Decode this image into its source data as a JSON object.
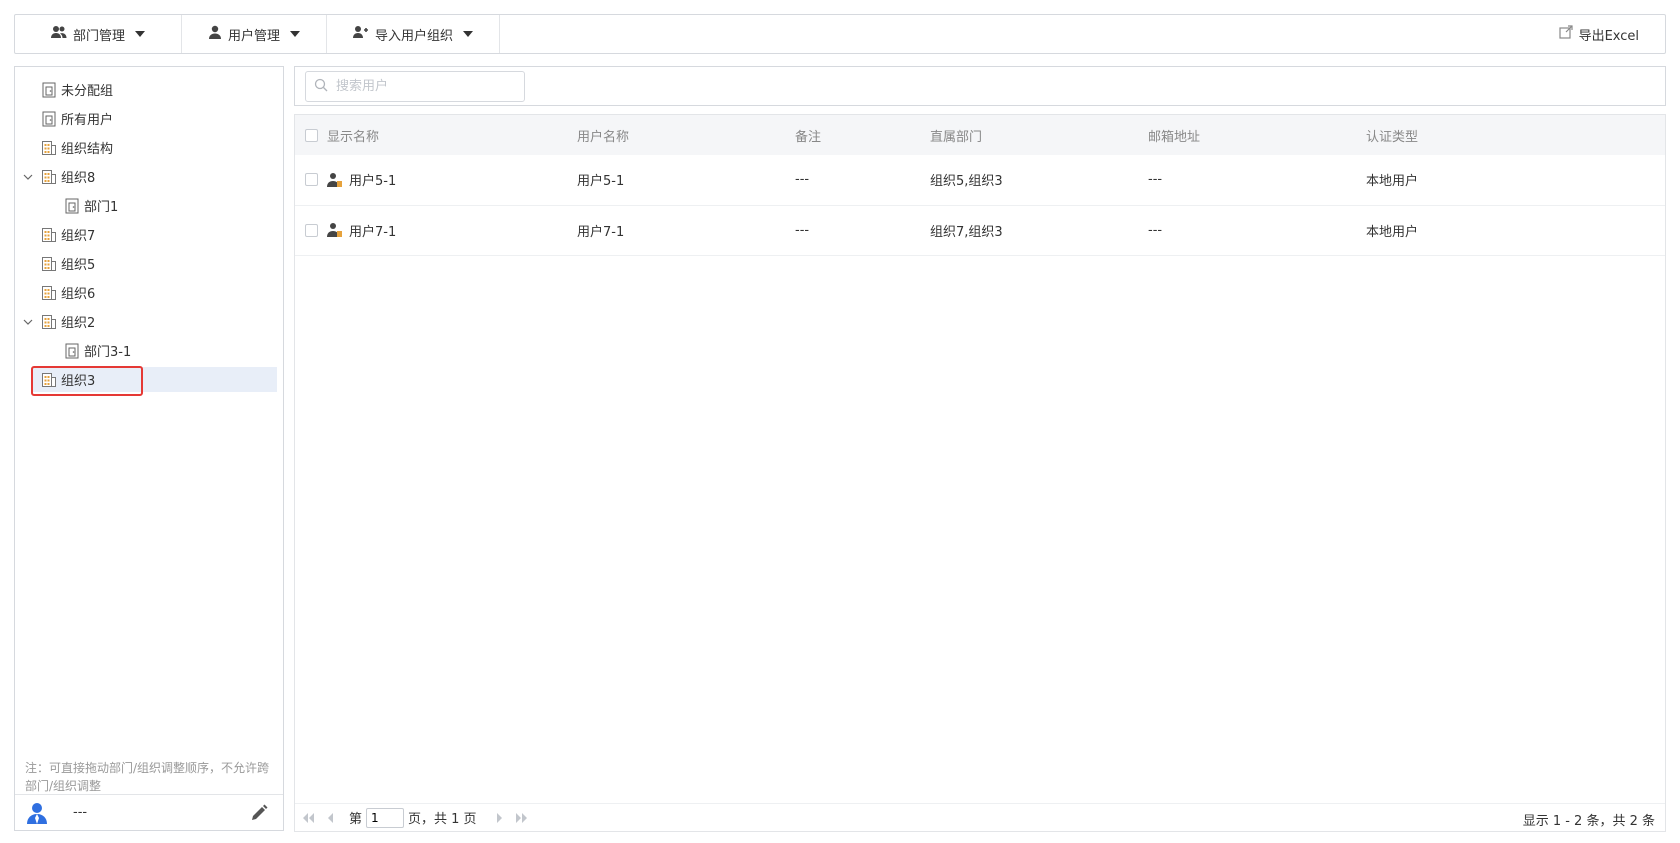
{
  "toolbar": {
    "dept_mgmt": "部门管理",
    "user_mgmt": "用户管理",
    "import": "导入用户组织",
    "export": "导出Excel"
  },
  "tree": {
    "items": [
      {
        "label": "未分配组",
        "icon": "dept-icon",
        "level": 0,
        "expanded": null
      },
      {
        "label": "所有用户",
        "icon": "dept-icon",
        "level": 0,
        "expanded": null
      },
      {
        "label": "组织结构",
        "icon": "org-icon",
        "level": 0,
        "expanded": null
      },
      {
        "label": "组织8",
        "icon": "org-icon",
        "level": 0,
        "expanded": true
      },
      {
        "label": "部门1",
        "icon": "dept-icon",
        "level": 1,
        "expanded": null
      },
      {
        "label": "组织7",
        "icon": "org-icon",
        "level": 0,
        "expanded": null
      },
      {
        "label": "组织5",
        "icon": "org-icon",
        "level": 0,
        "expanded": null
      },
      {
        "label": "组织6",
        "icon": "org-icon",
        "level": 0,
        "expanded": null
      },
      {
        "label": "组织2",
        "icon": "org-icon",
        "level": 0,
        "expanded": true
      },
      {
        "label": "部门3-1",
        "icon": "dept-icon",
        "level": 1,
        "expanded": null
      },
      {
        "label": "组织3",
        "icon": "org-icon",
        "level": 0,
        "expanded": null,
        "selected": true
      }
    ]
  },
  "note": "注：可直接拖动部门/组织调整顺序，不允许跨部门/组织调整",
  "footer_user": "---",
  "search": {
    "placeholder": "搜索用户"
  },
  "table": {
    "headers": [
      "显示名称",
      "用户名称",
      "备注",
      "直属部门",
      "邮箱地址",
      "认证类型"
    ],
    "rows": [
      {
        "display": "用户5-1",
        "username": "用户5-1",
        "remark": "---",
        "dept": "组织5,组织3",
        "email": "---",
        "auth": "本地用户"
      },
      {
        "display": "用户7-1",
        "username": "用户7-1",
        "remark": "---",
        "dept": "组织7,组织3",
        "email": "---",
        "auth": "本地用户"
      }
    ]
  },
  "pager": {
    "prefix": "第",
    "page": "1",
    "suffix": "页，共 1 页",
    "summary": "显示 1 - 2 条，共 2 条"
  },
  "colors": {
    "selected_bg": "#e8eef8",
    "highlight": "#e53935",
    "accent": "#2f6fe0"
  }
}
